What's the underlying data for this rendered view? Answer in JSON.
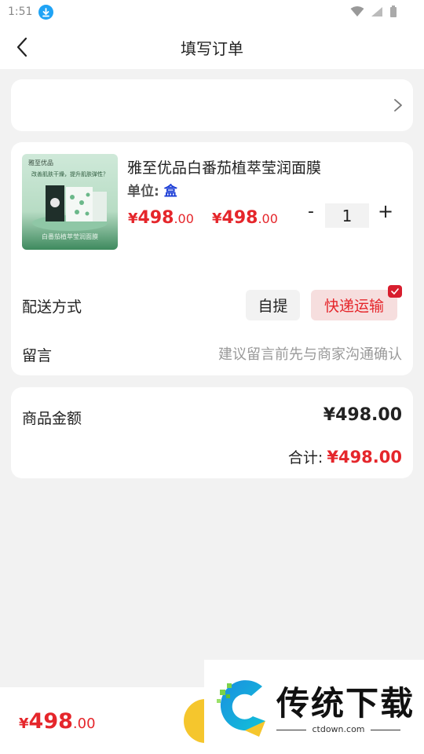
{
  "status_bar": {
    "time": "1:51"
  },
  "header": {
    "title": "填写订单"
  },
  "product": {
    "name": "雅至优品白番茄植萃莹润面膜",
    "unit_label": "单位:",
    "unit_value": "盒",
    "price_symbol": "¥",
    "price_int": "498",
    "price_dec": ".00",
    "quantity": "1",
    "image_caption": "白番茄植萃莹润面膜",
    "image_tagline": "改善肌肤干燥，提升肌肤弹性？"
  },
  "delivery": {
    "label": "配送方式",
    "options": [
      "自提",
      "快递运输"
    ],
    "selected": "快递运输"
  },
  "message": {
    "label": "留言",
    "placeholder": "建议留言前先与商家沟通确认"
  },
  "totals": {
    "goods_label": "商品金额",
    "goods_amount": "¥498.00",
    "sum_label": "合计:",
    "sum_amount": "¥498.00"
  },
  "bottom_bar": {
    "price_symbol": "¥",
    "price_int": "498",
    "price_dec": ".00"
  },
  "watermark": {
    "brand": "传统下载",
    "url": "ctdown.com"
  },
  "colors": {
    "accent_red": "#e5262b",
    "unit_blue": "#1b3dd6",
    "submit_yellow": "#f5c62d",
    "selected_bg": "#f6dede"
  }
}
